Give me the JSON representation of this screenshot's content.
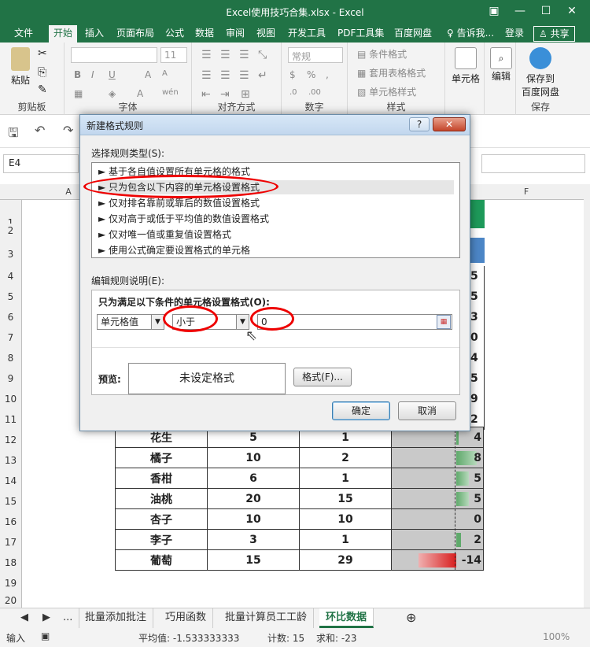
{
  "window": {
    "title": "Excel使用技巧合集.xlsx - Excel"
  },
  "ribbon_tabs": [
    "文件",
    "开始",
    "插入",
    "页面布局",
    "公式",
    "数据",
    "审阅",
    "视图",
    "开发工具",
    "PDF工具集",
    "百度网盘"
  ],
  "ribbon_right": {
    "tell": "告诉我...",
    "login": "登录",
    "share": "共享"
  },
  "ribbon": {
    "clipboard": {
      "paste": "粘贴",
      "label": "剪贴板"
    },
    "font": {
      "size": "11",
      "label": "字体"
    },
    "alignment": {
      "label": "对齐方式"
    },
    "number": {
      "format": "常规",
      "label": "数字"
    },
    "styles": {
      "cond": "条件格式",
      "table": "套用表格格式",
      "cell": "单元格样式",
      "label": "样式"
    },
    "cells": {
      "label": "单元格"
    },
    "editing": {
      "label": "编辑"
    },
    "save": {
      "line1": "保存到",
      "line2": "百度网盘",
      "label": "保存"
    }
  },
  "namebox": "E4",
  "columns": [
    "A",
    "F"
  ],
  "rows": [
    "1",
    "2",
    "3",
    "4",
    "5",
    "6",
    "7",
    "8",
    "9",
    "10",
    "11",
    "12",
    "13",
    "14",
    "15",
    "16",
    "17",
    "18",
    "19",
    "20"
  ],
  "table_rows": [
    {
      "name": "花生",
      "a": "5",
      "b": "1",
      "c": "4"
    },
    {
      "name": "橘子",
      "a": "10",
      "b": "2",
      "c": "8"
    },
    {
      "name": "香柑",
      "a": "6",
      "b": "1",
      "c": "5"
    },
    {
      "name": "油桃",
      "a": "20",
      "b": "15",
      "c": "5"
    },
    {
      "name": "杏子",
      "a": "10",
      "b": "10",
      "c": "0"
    },
    {
      "name": "李子",
      "a": "3",
      "b": "1",
      "c": "2"
    },
    {
      "name": "葡萄",
      "a": "15",
      "b": "29",
      "c": "-14"
    }
  ],
  "hidden_right_col": [
    "5",
    "5",
    "3",
    "0",
    "4",
    "5",
    "9",
    "2"
  ],
  "dialog": {
    "title": "新建格式规则",
    "help": "?",
    "close": "✕",
    "select_type_label": "选择规则类型(S):",
    "rule_types": [
      "基于各自值设置所有单元格的格式",
      "只为包含以下内容的单元格设置格式",
      "仅对排名靠前或靠后的数值设置格式",
      "仅对高于或低于平均值的数值设置格式",
      "仅对唯一值或重复值设置格式",
      "使用公式确定要设置格式的单元格"
    ],
    "edit_label": "编辑规则说明(E):",
    "cond_label": "只为满足以下条件的单元格设置格式(O):",
    "field1": "单元格值",
    "field2": "小于",
    "field3": "0",
    "preview_label": "预览:",
    "preview_text": "未设定格式",
    "format_btn": "格式(F)...",
    "ok": "确定",
    "cancel": "取消"
  },
  "sheet_tabs": [
    "...",
    "批量添加批注",
    "巧用函数",
    "批量计算员工工龄",
    "环比数据"
  ],
  "status": {
    "mode": "输入",
    "avg": "平均值: -1.533333333",
    "count": "计数: 15",
    "sum": "求和: -23",
    "zoom": "100%"
  },
  "colors": {
    "accent": "#217346",
    "highlight": "#e00000"
  }
}
